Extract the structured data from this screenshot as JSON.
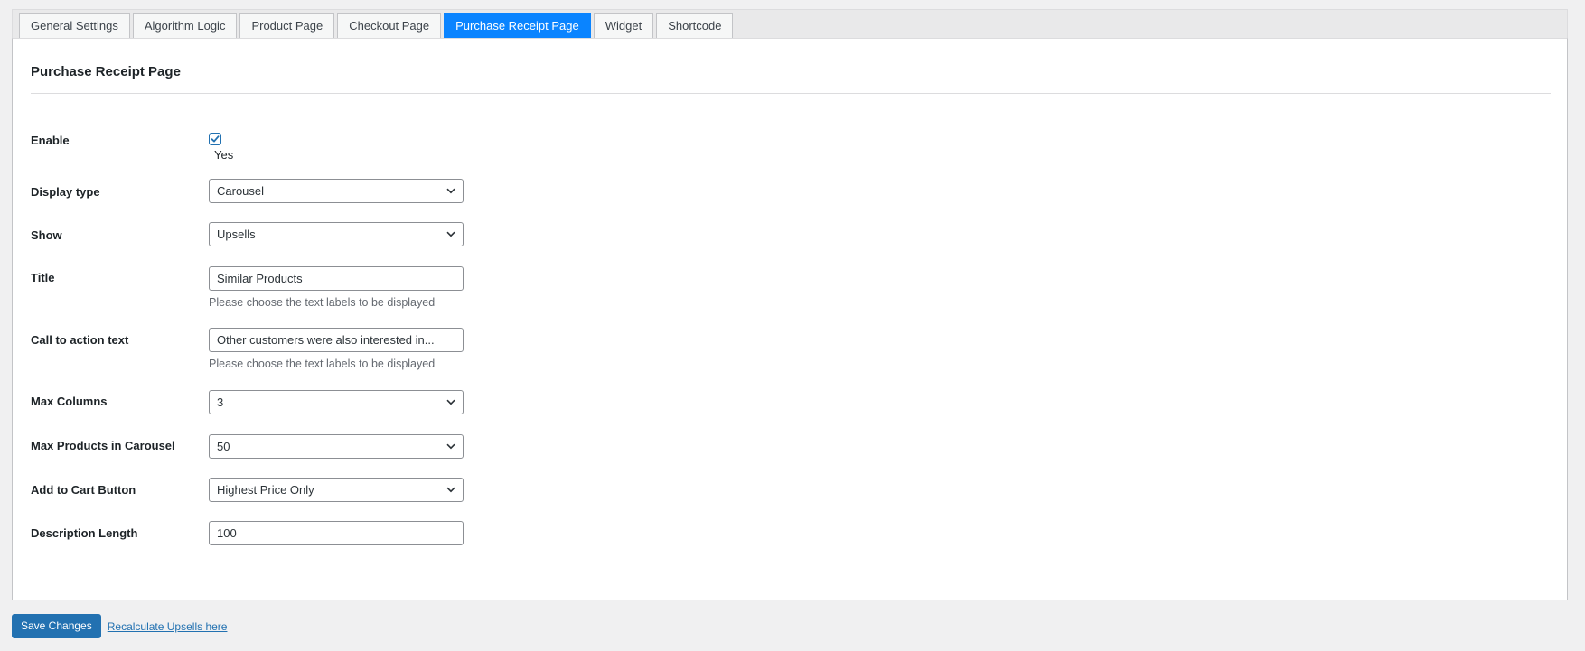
{
  "tabs": [
    {
      "label": "General Settings",
      "active": false
    },
    {
      "label": "Algorithm Logic",
      "active": false
    },
    {
      "label": "Product Page",
      "active": false
    },
    {
      "label": "Checkout Page",
      "active": false
    },
    {
      "label": "Purchase Receipt Page",
      "active": true
    },
    {
      "label": "Widget",
      "active": false
    },
    {
      "label": "Shortcode",
      "active": false
    }
  ],
  "panel": {
    "title": "Purchase Receipt Page"
  },
  "fields": {
    "enable": {
      "label": "Enable",
      "checked": true,
      "option_label": "Yes"
    },
    "display_type": {
      "label": "Display type",
      "value": "Carousel"
    },
    "show": {
      "label": "Show",
      "value": "Upsells"
    },
    "title": {
      "label": "Title",
      "value": "Similar Products",
      "description": "Please choose the text labels to be displayed"
    },
    "cta_text": {
      "label": "Call to action text",
      "value": "Other customers were also interested in...",
      "description": "Please choose the text labels to be displayed"
    },
    "max_columns": {
      "label": "Max Columns",
      "value": "3"
    },
    "max_products": {
      "label": "Max Products in Carousel",
      "value": "50"
    },
    "add_to_cart": {
      "label": "Add to Cart Button",
      "value": "Highest Price Only"
    },
    "description_length": {
      "label": "Description Length",
      "value": "100"
    }
  },
  "footer": {
    "save_label": "Save Changes",
    "recalc_link": "Recalculate Upsells here"
  },
  "colors": {
    "accent": "#2271b1",
    "active_tab": "#0a84ff"
  },
  "icons": {
    "select_arrow": "chevron-down-icon",
    "check": "checkmark-icon"
  }
}
